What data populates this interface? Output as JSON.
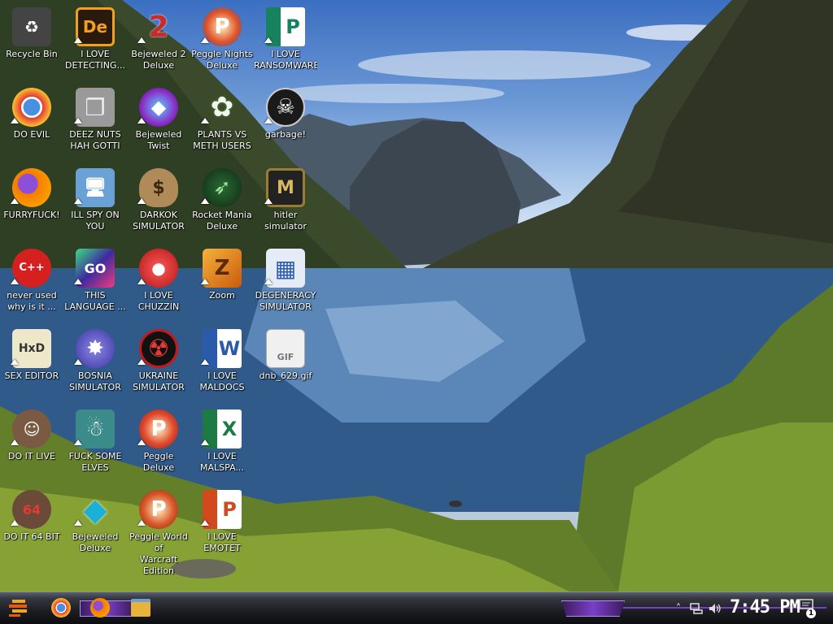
{
  "desktop": {
    "icons": [
      {
        "label": "Recycle Bin",
        "icon": "recycle-bin-icon",
        "color": "#444",
        "glyph": "♻"
      },
      {
        "label": "I LOVE\nDETECTING...",
        "icon": "dreamweaver-icon",
        "color": "#f4a01b",
        "glyph": "De"
      },
      {
        "label": "Bejeweled 2\nDeluxe",
        "icon": "bejeweled-2-icon",
        "color": "#c92b2b",
        "glyph": "2"
      },
      {
        "label": "Peggle Nights\nDeluxe",
        "icon": "peggle-nights-icon",
        "color": "#e0552a",
        "glyph": "P"
      },
      {
        "label": "I LOVE\nRANSOMWARE",
        "icon": "publisher-icon",
        "color": "#17825e",
        "glyph": "P"
      },
      {
        "label": "DO EVIL",
        "icon": "chrome-icon",
        "color": "#2f8d3e",
        "glyph": "◉"
      },
      {
        "label": "DEEZ NUTS\nHAH GOTTI",
        "icon": "windows-stack-icon",
        "color": "#8c8c8c",
        "glyph": "❐"
      },
      {
        "label": "Bejeweled\nTwist",
        "icon": "bejeweled-twist-icon",
        "color": "#8a2fc7",
        "glyph": "◆"
      },
      {
        "label": "PLANTS VS\nMETH USERS",
        "icon": "plants-vs-zombies-icon",
        "color": "#4b9a2b",
        "glyph": "✿"
      },
      {
        "label": "garbage!",
        "icon": "gimp-icon",
        "color": "#2a2a2a",
        "glyph": "☠"
      },
      {
        "label": "FURRYFUCK!",
        "icon": "firefox-icon",
        "color": "#ea6b14",
        "glyph": "🦊"
      },
      {
        "label": "ILL SPY ON\nYOU",
        "icon": "remote-desktop-icon",
        "color": "#6aa2d8",
        "glyph": "🖥"
      },
      {
        "label": "DARKOK\nSIMULATOR",
        "icon": "money-bag-icon",
        "color": "#b08a58",
        "glyph": "$"
      },
      {
        "label": "Rocket Mania\nDeluxe",
        "icon": "rocket-mania-icon",
        "color": "#1d4f25",
        "glyph": "➶"
      },
      {
        "label": "hitler simulator",
        "icon": "medal-icon",
        "color": "#9a7d33",
        "glyph": "M"
      },
      {
        "label": "never used\nwhy is it ...",
        "icon": "dev-cpp-icon",
        "color": "#d62020",
        "glyph": "C++"
      },
      {
        "label": "THIS\nLANGUAGE ...",
        "icon": "goland-icon",
        "color": "#3e2aa0",
        "glyph": "GO"
      },
      {
        "label": "I LOVE\nCHUZZIN",
        "icon": "chuzzle-icon",
        "color": "#d82828",
        "glyph": "●"
      },
      {
        "label": "Zoom",
        "icon": "zuma-icon",
        "color": "#d97b13",
        "glyph": "Z"
      },
      {
        "label": "DEGENERACY\nSIMULATOR",
        "icon": "virtualbox-icon",
        "color": "#2d5aa8",
        "glyph": "▦"
      },
      {
        "label": "SEX EDITOR",
        "icon": "hxd-icon",
        "color": "#ede8c9",
        "glyph": "HxD"
      },
      {
        "label": "BOSNIA\nSIMULATOR",
        "icon": "mine-icon",
        "color": "#5b55c5",
        "glyph": "✸"
      },
      {
        "label": "UKRAINE\nSIMULATOR",
        "icon": "radiation-icon",
        "color": "#c11b1b",
        "glyph": "☢"
      },
      {
        "label": "I LOVE\nMALDOCS",
        "icon": "word-icon",
        "color": "#2b5aaa",
        "glyph": "W"
      },
      {
        "label": "dnb_629.gif",
        "icon": "gif-file-icon",
        "color": "#e9e9e9",
        "glyph": "GIF"
      },
      {
        "label": "DO IT LIVE",
        "icon": "portrait-icon",
        "color": "#7b5a43",
        "glyph": "☺"
      },
      {
        "label": "FUCK SOME\nELVES",
        "icon": "santa-icon",
        "color": "#3a8b8a",
        "glyph": "☃"
      },
      {
        "label": "Peggle Deluxe",
        "icon": "peggle-deluxe-icon",
        "color": "#e04a2e",
        "glyph": "P"
      },
      {
        "label": "I LOVE\nMALSPA...",
        "icon": "excel-icon",
        "color": "#1e7a43",
        "glyph": "X"
      },
      {
        "label": "DO IT 64 BIT",
        "icon": "portrait-64-icon",
        "color": "#6b4a3a",
        "glyph": "64"
      },
      {
        "label": "Bejeweled\nDeluxe",
        "icon": "diamond-icon",
        "color": "#1ab0d8",
        "glyph": "◆"
      },
      {
        "label": "Peggle World of\nWarcraft Edition",
        "icon": "peggle-wow-icon",
        "color": "#d9582a",
        "glyph": "P"
      },
      {
        "label": "I LOVE EMOTET",
        "icon": "powerpoint-icon",
        "color": "#d2491d",
        "glyph": "P"
      }
    ]
  },
  "taskbar": {
    "clock": "7:45 PM",
    "start_icon": "start-logo-icon",
    "pinned": [
      {
        "name": "chrome",
        "icon": "chrome-icon",
        "color": "#2f8d3e"
      },
      {
        "name": "firefox",
        "icon": "firefox-icon",
        "color": "#ea6b14"
      },
      {
        "name": "explorer",
        "icon": "folder-icon",
        "color": "#e7b33b"
      }
    ],
    "tray": [
      "chevron-up-icon",
      "network-icon",
      "volume-icon"
    ],
    "notification_count": "1"
  }
}
